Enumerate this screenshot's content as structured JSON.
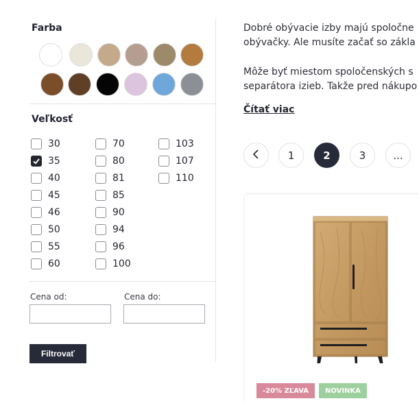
{
  "filters": {
    "color": {
      "title": "Farba",
      "swatches": [
        {
          "name": "white",
          "hex": "#ffffff"
        },
        {
          "name": "cream",
          "hex": "#ebe6da"
        },
        {
          "name": "sand",
          "hex": "#c4a98b"
        },
        {
          "name": "taupe",
          "hex": "#b59e91"
        },
        {
          "name": "olive-oak",
          "hex": "#9c8a6a"
        },
        {
          "name": "honey-oak",
          "hex": "#b37c3e"
        },
        {
          "name": "walnut",
          "hex": "#7a4e28"
        },
        {
          "name": "dark-walnut",
          "hex": "#5f3f26"
        },
        {
          "name": "black",
          "hex": "#050505"
        },
        {
          "name": "lilac",
          "hex": "#dcc4df"
        },
        {
          "name": "sky-blue",
          "hex": "#6fa7db"
        },
        {
          "name": "grey",
          "hex": "#8c8f96"
        }
      ]
    },
    "size": {
      "title": "Veľkosť",
      "columns": [
        [
          {
            "label": "30",
            "checked": false
          },
          {
            "label": "35",
            "checked": true
          },
          {
            "label": "40",
            "checked": false
          },
          {
            "label": "45",
            "checked": false
          },
          {
            "label": "46",
            "checked": false
          },
          {
            "label": "50",
            "checked": false
          },
          {
            "label": "55",
            "checked": false
          },
          {
            "label": "60",
            "checked": false
          }
        ],
        [
          {
            "label": "70",
            "checked": false
          },
          {
            "label": "80",
            "checked": false
          },
          {
            "label": "81",
            "checked": false
          },
          {
            "label": "85",
            "checked": false
          },
          {
            "label": "90",
            "checked": false
          },
          {
            "label": "94",
            "checked": false
          },
          {
            "label": "96",
            "checked": false
          },
          {
            "label": "100",
            "checked": false
          }
        ],
        [
          {
            "label": "103",
            "checked": false
          },
          {
            "label": "107",
            "checked": false
          },
          {
            "label": "110",
            "checked": false
          }
        ]
      ]
    },
    "price": {
      "from_label": "Cena od:",
      "to_label": "Cena do:",
      "from_value": "",
      "to_value": ""
    },
    "submit_label": "Filtrovať"
  },
  "content": {
    "paragraph1": [
      "Dobré obývacie izby majú spoločne",
      "obývačky. Ale musíte začať so zákla"
    ],
    "paragraph2": [
      "Môže byť miestom spoločenských s",
      "separátora izieb. Takže pred nákupo"
    ],
    "read_more": "Čítať viac"
  },
  "pagination": {
    "prev_icon": "chevron-left-icon",
    "pages": [
      "1",
      "2",
      "3"
    ],
    "current": "2",
    "more": "..."
  },
  "product": {
    "image_icon": "wardrobe-icon",
    "badges": {
      "sale": "-20% ZĽAVA",
      "new": "NOVINKA"
    },
    "colors": {
      "sale": "#d98a9a",
      "new": "#9ecf9e",
      "wood": "#c9a26b"
    }
  },
  "accent": "#272a38"
}
